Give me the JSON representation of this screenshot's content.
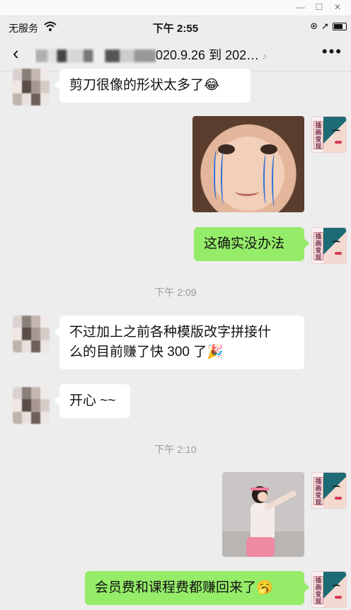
{
  "status": {
    "carrier": "无服务",
    "time": "下午 2:55",
    "icons": [
      "orientation-lock-icon",
      "location-icon",
      "battery-icon"
    ]
  },
  "nav": {
    "title_suffix": "020.9.26 到 202…",
    "back_icon": "chevron-left-icon",
    "more_icon": "more-icon",
    "muted_icon": "ear-icon"
  },
  "messages": [
    {
      "side": "left",
      "type": "text",
      "text": "剪刀很像的形状太多了",
      "emoji": "😂"
    },
    {
      "side": "right",
      "type": "image",
      "desc": "crying-baby-photo"
    },
    {
      "side": "right",
      "type": "text",
      "text": "这确实没办法"
    },
    {
      "type": "time",
      "text": "下午 2:09"
    },
    {
      "side": "left",
      "type": "text",
      "line1": "不过加上之前各种模版改字拼接什",
      "line2": "么的目前赚了快 300 了",
      "emoji": "🎉"
    },
    {
      "side": "left",
      "type": "text",
      "text": "开心 ~~"
    },
    {
      "type": "time",
      "text": "下午 2:10"
    },
    {
      "side": "right",
      "type": "image",
      "desc": "dancing-girl-photo"
    },
    {
      "side": "right",
      "type": "text",
      "text": "会员费和课程费都赚回来了",
      "emoji": "🥱"
    }
  ],
  "self_avatar_label": "插画变现",
  "colors": {
    "bubble_green": "#95ec69",
    "bubble_white": "#ffffff",
    "background": "#ededed"
  }
}
